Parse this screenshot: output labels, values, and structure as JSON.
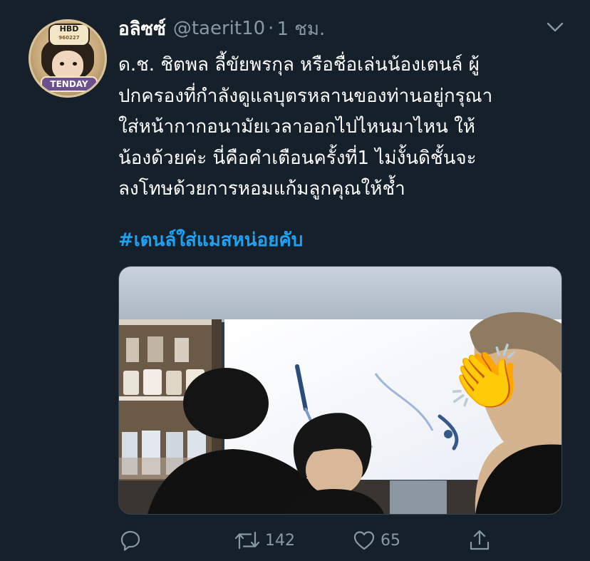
{
  "tweet": {
    "display_name": "อลิซซ์",
    "handle": "@taerit10",
    "separator": "·",
    "time": "1 ชม.",
    "text_lines": [
      "ด.ช. ชิตพล ลี้ขัยพรกุล หรือชื่อเล่นน้องเตนล์ ผู้",
      "ปกครองที่กำลังดูแลบุตรหลานของท่านอยู่กรุณา",
      "ใส่หน้ากากอนามัยเวลาออกไปไหนมาไหน ให้",
      "น้องด้วยค่ะ นี่คือคำเตือนครั้งที่1 ไม่งั้นดิชั้นจะ",
      "ลงโทษด้วยการหอมแก้มลูกคุณให้ช้ำ"
    ],
    "hashtag": "#เตนล์ใส่แมสหน่อยคับ",
    "media_emoji": "👏"
  },
  "avatar": {
    "badge_top": "HBD",
    "badge_top_sub": "960227",
    "badge_bottom": "TENDAY"
  },
  "actions": {
    "reply_count": "",
    "retweet_count": "142",
    "like_count": "65",
    "share_count": ""
  },
  "icons": {
    "menu": "chevron-down-icon",
    "reply": "reply-icon",
    "retweet": "retweet-icon",
    "like": "heart-icon",
    "share": "share-icon"
  },
  "colors": {
    "background": "#15202b",
    "primary_text": "#ffffff",
    "secondary_text": "#8899a6",
    "link": "#1da1f2",
    "border": "#38444d"
  }
}
